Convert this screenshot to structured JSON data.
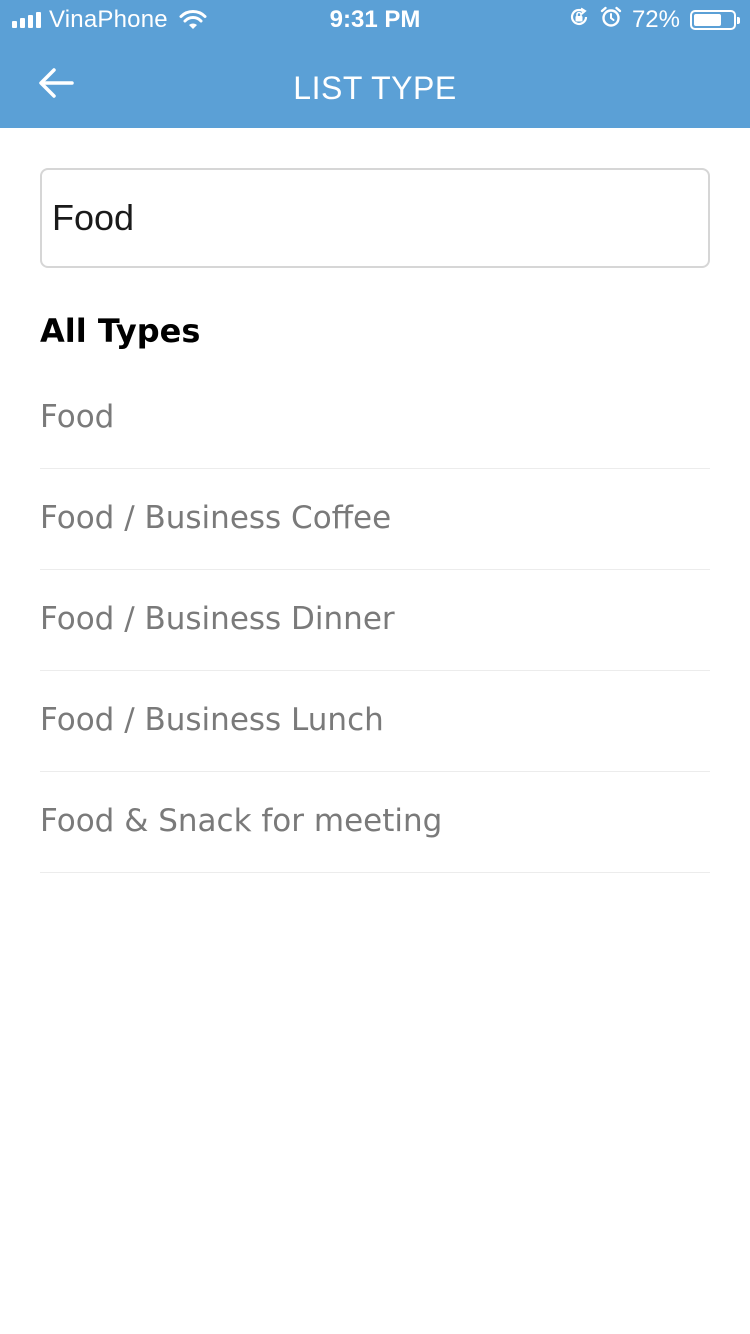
{
  "status_bar": {
    "carrier": "VinaPhone",
    "time": "9:31 PM",
    "battery_percent": "72%",
    "battery_level": 0.72,
    "icons": [
      "signal-icon",
      "wifi-icon",
      "orientation-lock-icon",
      "alarm-icon",
      "battery-icon"
    ]
  },
  "header": {
    "title": "LIST TYPE",
    "back_icon": "arrow-left-icon",
    "background_color": "#5ba0d6"
  },
  "search": {
    "value": "Food",
    "placeholder": ""
  },
  "section": {
    "title": "All Types"
  },
  "types": [
    {
      "label": "Food"
    },
    {
      "label": "Food / Business Coffee"
    },
    {
      "label": "Food / Business Dinner"
    },
    {
      "label": "Food / Business Lunch"
    },
    {
      "label": "Food & Snack for meeting"
    }
  ]
}
